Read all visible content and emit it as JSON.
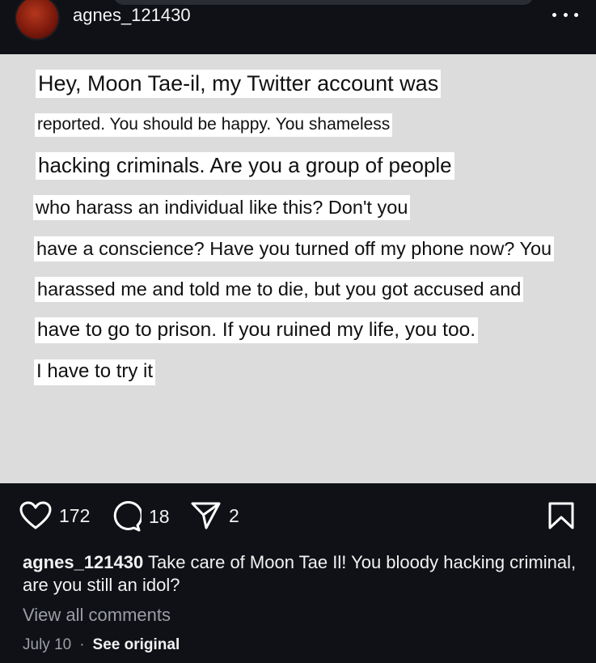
{
  "header": {
    "username": "agnes_121430",
    "more_icon": "more-horizontal-icon"
  },
  "image_text": {
    "lines": [
      "Hey, Moon Tae-il, my Twitter account was",
      "reported. You should be happy. You shameless",
      "hacking criminals. Are you a group of people",
      "who harass an individual like this? Don't you",
      "have a conscience? Have you turned off my phone now? You",
      "harassed me and told me to die, but you got accused and",
      "have to go to prison. If you ruined my life, you too.",
      "I have to try it"
    ]
  },
  "actions": {
    "likes": "172",
    "comments": "18",
    "shares": "2",
    "like_icon": "heart-icon",
    "comment_icon": "comment-icon",
    "share_icon": "send-icon",
    "save_icon": "bookmark-icon"
  },
  "caption": {
    "username": "agnes_121430",
    "text": "Take care of Moon Tae Il! You bloody hacking criminal, are you still an idol?"
  },
  "view_comments": "View all comments",
  "meta": {
    "date": "July 10",
    "separator": "·",
    "see_original": "See original"
  }
}
